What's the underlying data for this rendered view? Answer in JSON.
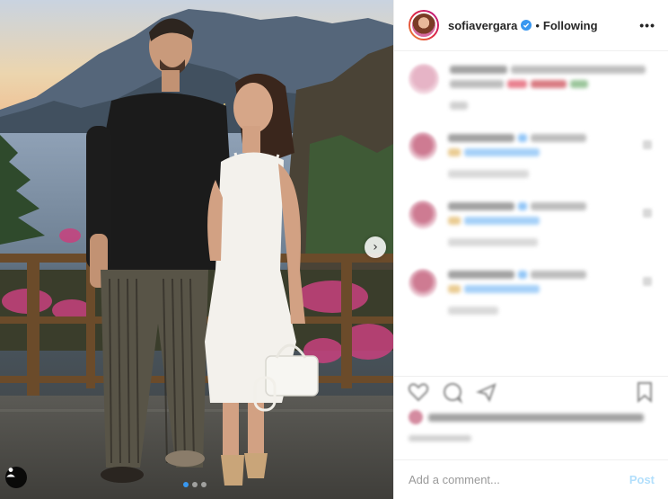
{
  "header": {
    "username": "sofiavergara",
    "separator": "•",
    "follow_status": "Following",
    "more_label": "•••"
  },
  "photo": {
    "carousel_total": 3,
    "carousel_active": 1
  },
  "comment_box": {
    "placeholder": "Add a comment...",
    "post_label": "Post"
  },
  "colors": {
    "link_blue": "#3897f0",
    "post_disabled": "#b2dffc",
    "divider": "#efefef"
  },
  "icons": [
    "verified-icon",
    "more-options-icon",
    "next-arrow-icon",
    "tag-user-icon",
    "heart-icon",
    "comment-icon",
    "share-icon",
    "save-icon"
  ]
}
